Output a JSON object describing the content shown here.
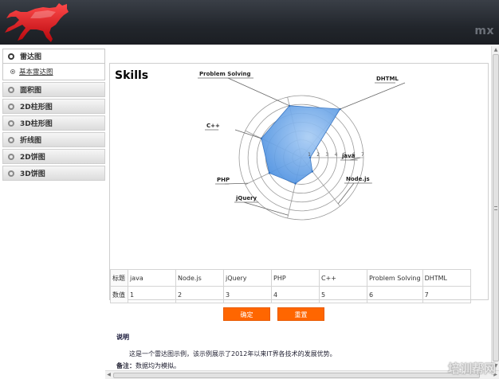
{
  "header": {
    "brand": "mx",
    "logo_icon": "horse-logo-icon",
    "accent": "#d9161c"
  },
  "sidebar": {
    "groups": [
      {
        "label": "雷达图",
        "open": true,
        "children": [
          {
            "label": "基本雷达图"
          }
        ]
      },
      {
        "label": "面积图",
        "open": false
      },
      {
        "label": "2D柱形图",
        "open": false
      },
      {
        "label": "3D柱形图",
        "open": false
      },
      {
        "label": "折线图",
        "open": false
      },
      {
        "label": "2D饼图",
        "open": false
      },
      {
        "label": "3D饼图",
        "open": false
      }
    ]
  },
  "chart_data": {
    "type": "radar",
    "title": "Skills",
    "categories": [
      "java",
      "Node.js",
      "jQuery",
      "PHP",
      "C++",
      "Problem Solving",
      "DHTML"
    ],
    "values": [
      1,
      2,
      3,
      4,
      5,
      6,
      7
    ],
    "ticks": [
      1,
      2,
      3,
      4,
      5,
      6,
      7
    ],
    "range": [
      0,
      7
    ],
    "fill_color": "#4a90e2",
    "grid": true
  },
  "table": {
    "rows": [
      {
        "header": "标题",
        "cells": [
          "java",
          "Node.js",
          "jQuery",
          "PHP",
          "C++",
          "Problem Solving",
          "DHTML"
        ]
      },
      {
        "header": "数值",
        "cells": [
          "1",
          "2",
          "3",
          "4",
          "5",
          "6",
          "7"
        ]
      }
    ]
  },
  "buttons": {
    "ok_label": "确定",
    "reset_label": "重置",
    "color": "#ff6600"
  },
  "notes": {
    "title": "说明",
    "description": "这是一个雷达图示例，该示例展示了2012年以来IT界各技术的发展优势。",
    "remark_label": "备注：",
    "remark_text": "数据均为模拟。"
  },
  "watermark": "培训帮网"
}
